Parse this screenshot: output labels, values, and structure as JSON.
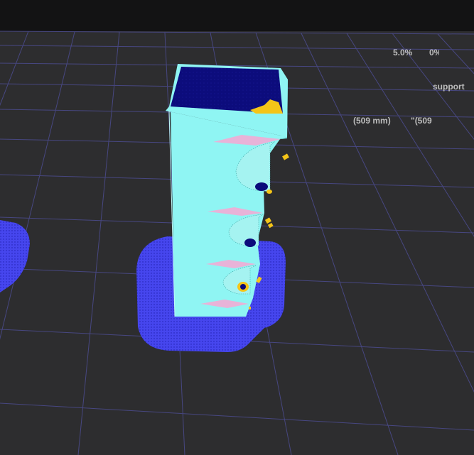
{
  "viewport": {
    "background_color": "#2d2d2f",
    "grid_color": "#4a4a8a",
    "model_color": "#8ff5f3",
    "model_shadow_color": "#5fc9c7",
    "top_face_color": "#0b0b7a",
    "raft_color": "#4a4af5",
    "overhang_color": "#e8b3d8",
    "support_marker_color": "#f5c518"
  },
  "overlay": {
    "infill_percent": "5.0%",
    "infill_percent_clipped": "0%",
    "support_label": "support",
    "size_mm": "(509 mm)",
    "size_in_clipped": "\"(509"
  }
}
